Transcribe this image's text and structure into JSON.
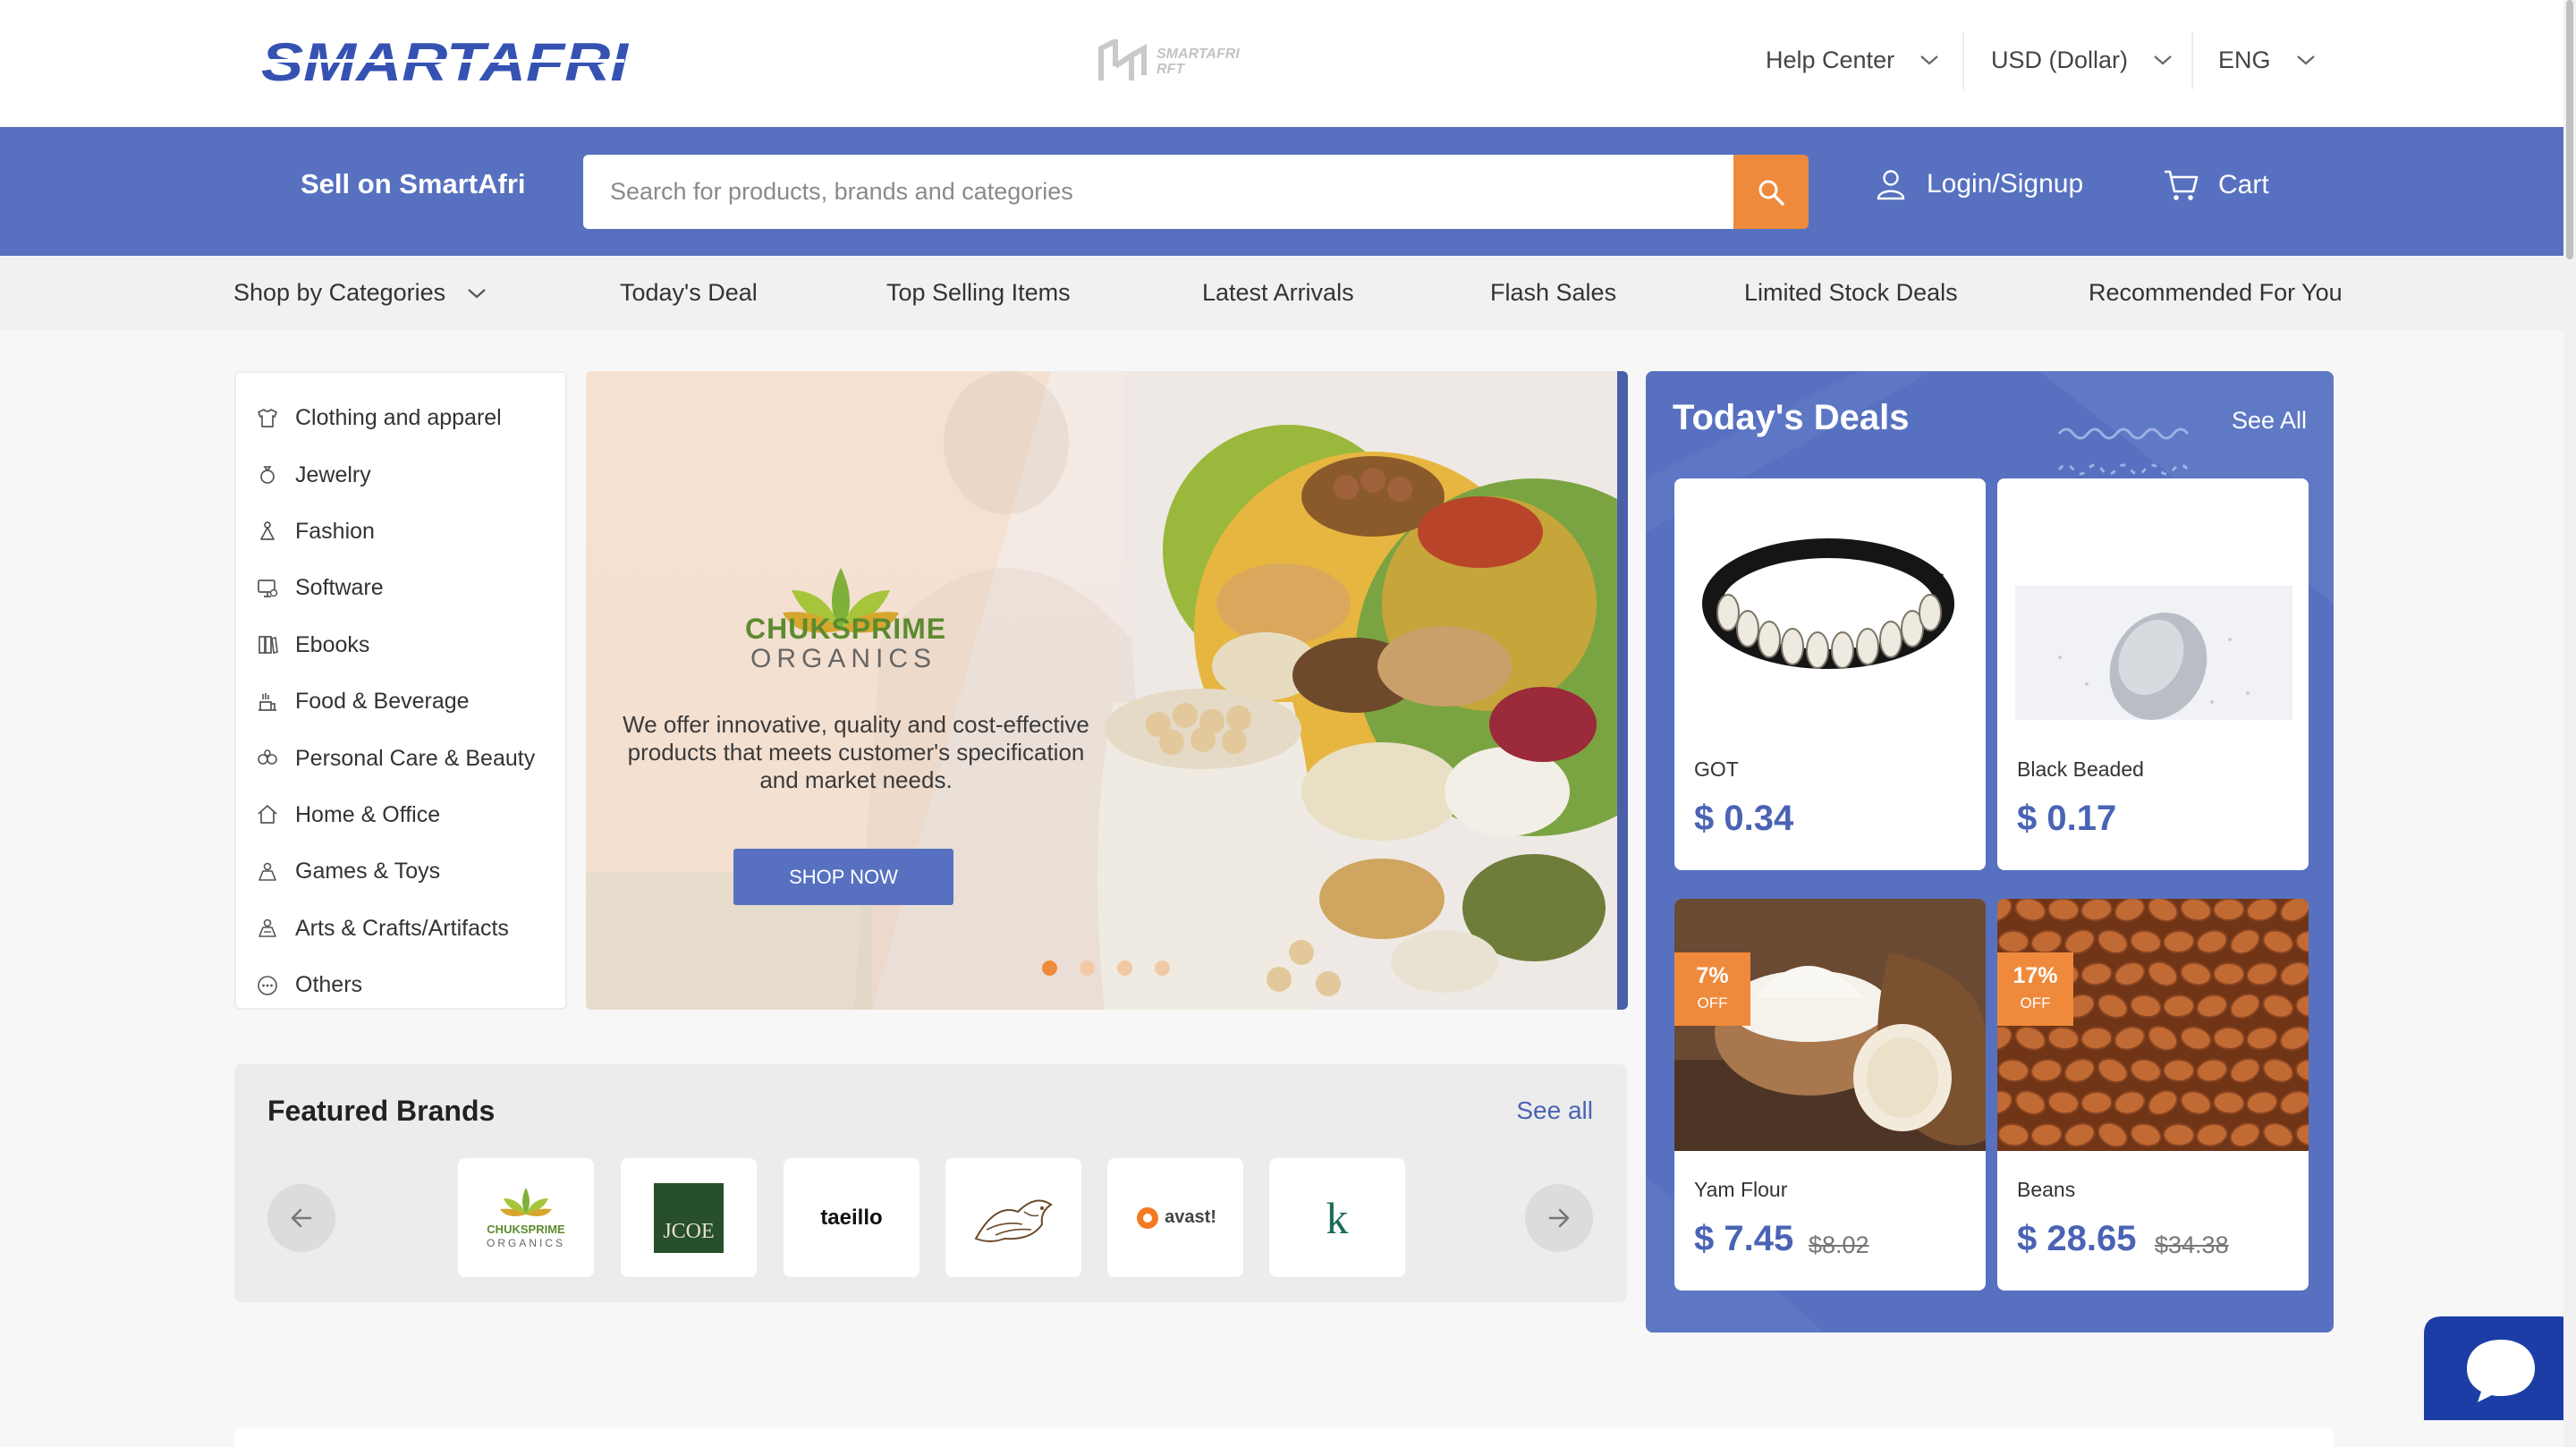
{
  "header": {
    "logo_text": "SMARTAFRI",
    "mini_logo_text_1": "SMARTAFRI",
    "mini_logo_text_2": "RFT",
    "help_center": "Help Center",
    "currency": "USD (Dollar)",
    "language": "ENG"
  },
  "nav": {
    "sell": "Sell on SmartAfri",
    "search_placeholder": "Search for products, brands and categories",
    "login": "Login/Signup",
    "cart": "Cart"
  },
  "category_bar": {
    "shop_by": "Shop by Categories",
    "links": [
      "Today's Deal",
      "Top Selling Items",
      "Latest Arrivals",
      "Flash Sales",
      "Limited Stock Deals",
      "Recommended For You"
    ]
  },
  "sidebar": {
    "items": [
      {
        "label": "Clothing and apparel",
        "icon": "clothing-icon"
      },
      {
        "label": "Jewelry",
        "icon": "jewelry-icon"
      },
      {
        "label": "Fashion",
        "icon": "fashion-icon"
      },
      {
        "label": "Software",
        "icon": "software-icon"
      },
      {
        "label": "Ebooks",
        "icon": "ebooks-icon"
      },
      {
        "label": "Food & Beverage",
        "icon": "food-icon"
      },
      {
        "label": "Personal Care & Beauty",
        "icon": "beauty-icon"
      },
      {
        "label": "Home & Office",
        "icon": "home-icon"
      },
      {
        "label": "Games & Toys",
        "icon": "games-icon"
      },
      {
        "label": "Arts & Crafts/Artifacts",
        "icon": "arts-icon"
      },
      {
        "label": "Others",
        "icon": "others-icon"
      }
    ]
  },
  "hero": {
    "brand_name": "CHUKSPRIME",
    "brand_sub": "ORGANICS",
    "copy": "We offer innovative, quality and cost-effective products that meets customer's specification and market needs.",
    "cta": "SHOP NOW",
    "slides": 4,
    "active_slide": 1
  },
  "featured_brands": {
    "title": "Featured Brands",
    "see_all": "See all",
    "brands": [
      {
        "name": "CHUKSPRIME",
        "sub": "ORGANICS"
      },
      {
        "name": "JCOE"
      },
      {
        "name": "taeillo"
      },
      {
        "name": "bird-logo"
      },
      {
        "name": "avast!"
      },
      {
        "name": "k"
      }
    ]
  },
  "deals": {
    "title": "Today's Deals",
    "see_all": "See All",
    "items": [
      {
        "name": "GOT",
        "price": "$ 0.34"
      },
      {
        "name": "Black Beaded",
        "price": "$ 0.17"
      },
      {
        "name": "Yam Flour",
        "price": "$ 7.45",
        "old_price": "$8.02",
        "badge_pct": "7%",
        "badge_off": "OFF"
      },
      {
        "name": "Beans",
        "price": "$ 28.65",
        "old_price": "$34.38",
        "badge_pct": "17%",
        "badge_off": "OFF"
      }
    ]
  },
  "colors": {
    "primary": "#5771c0",
    "accent": "#ef8a3c",
    "link": "#4a63b4",
    "chat": "#1c3da6"
  }
}
